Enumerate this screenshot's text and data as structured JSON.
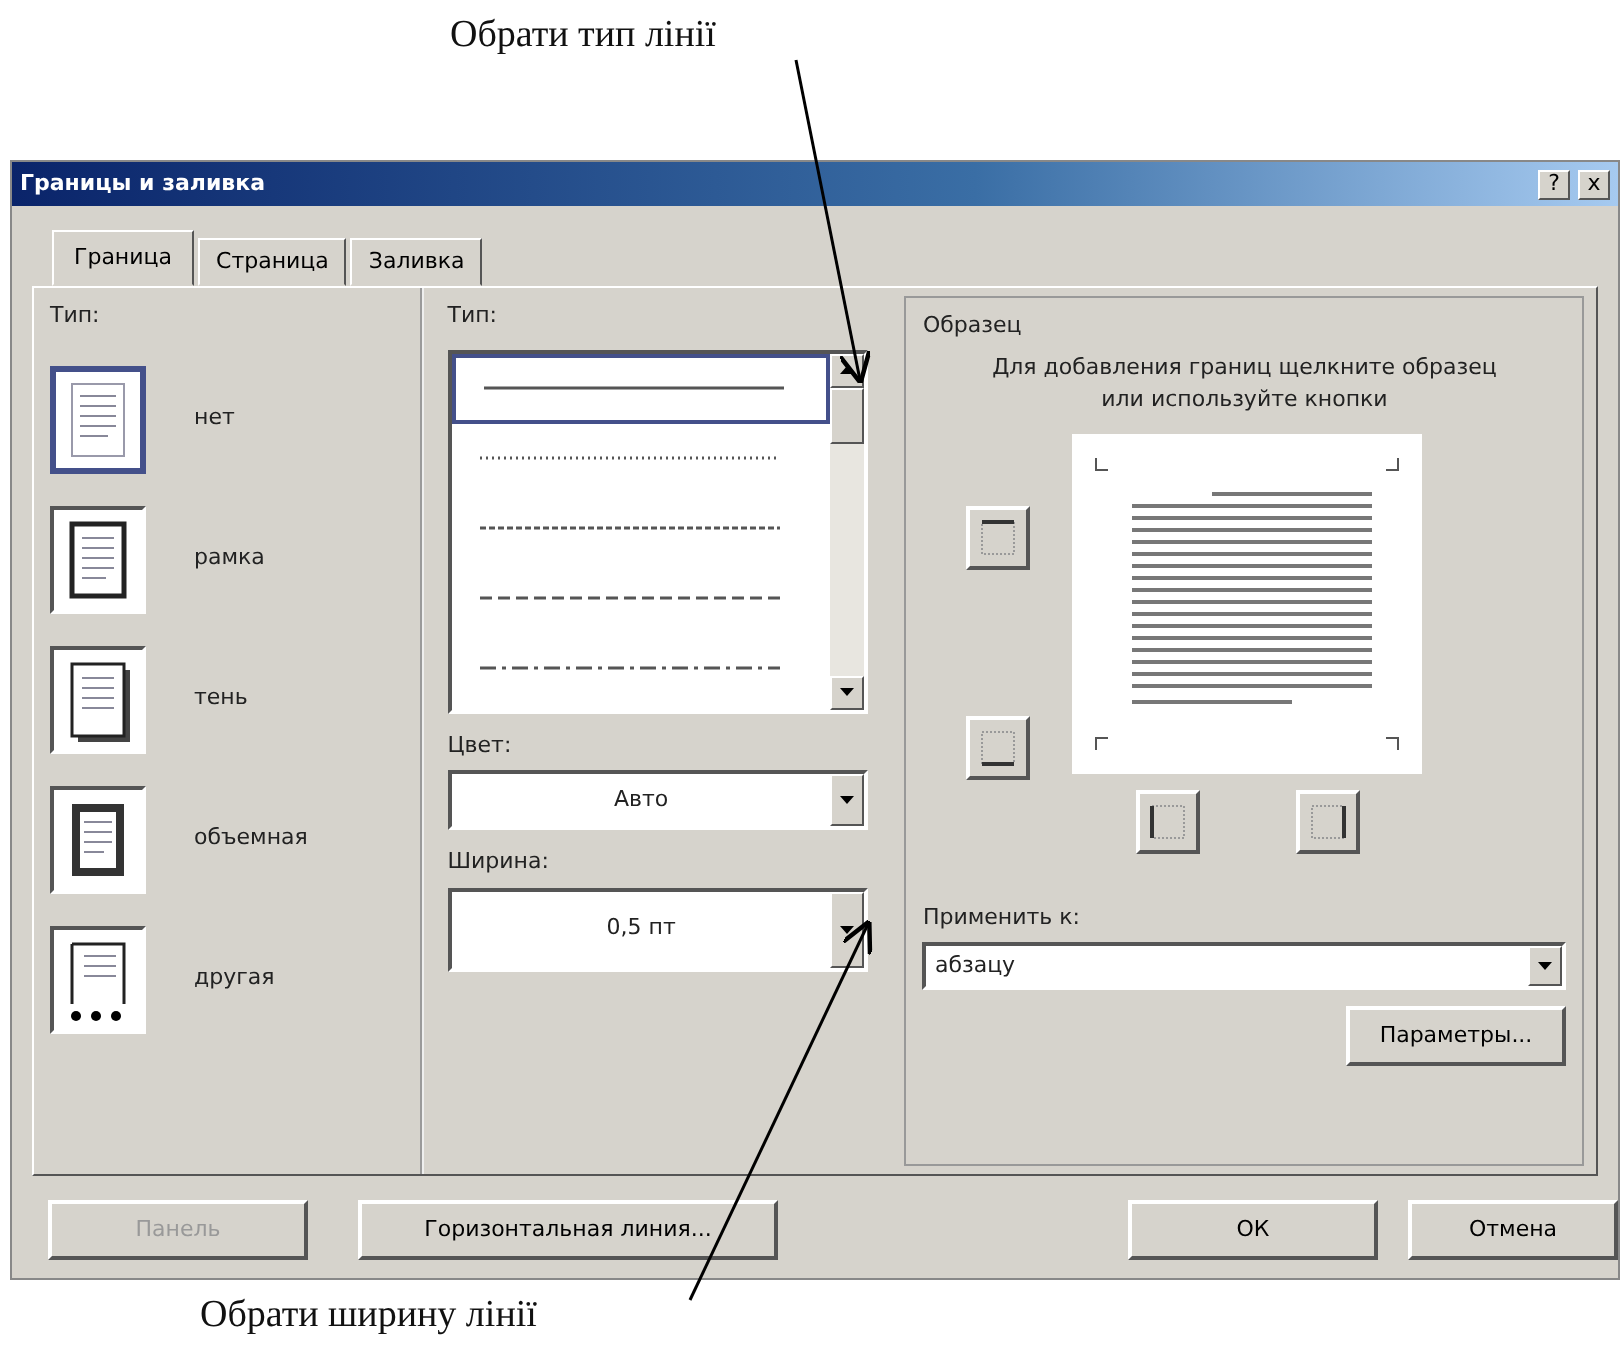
{
  "top_annotation": {
    "text": "Обрати тип лінії"
  },
  "bottom_annotation": {
    "text": "Обрати ширину лінії"
  },
  "window": {
    "title": "Границы и заливка",
    "title_buttons": [
      "?",
      "x"
    ]
  },
  "tabs": [
    {
      "label": "Граница",
      "selected": true
    },
    {
      "label": "Страница",
      "selected": false
    },
    {
      "label": "Заливка",
      "selected": false
    }
  ],
  "setting": {
    "label": "Тип:",
    "items": [
      {
        "label": "нет",
        "kind": "none",
        "selected": true
      },
      {
        "label": "рамка",
        "kind": "box",
        "selected": false
      },
      {
        "label": "тень",
        "kind": "shadow",
        "selected": false
      },
      {
        "label": "объемная",
        "kind": "raised",
        "selected": false
      },
      {
        "label": "другая",
        "kind": "custom",
        "selected": false
      }
    ]
  },
  "style": {
    "label": "Тип:",
    "lines": [
      {
        "kind": "solid",
        "selected": true
      },
      {
        "kind": "dotted",
        "selected": false
      },
      {
        "kind": "dense-dash",
        "selected": false
      },
      {
        "kind": "dashed",
        "selected": false
      },
      {
        "kind": "dash-dot",
        "selected": false
      }
    ]
  },
  "color": {
    "label": "Цвет:",
    "value": "Авто"
  },
  "width": {
    "label": "Ширина:",
    "value": "0,5 пт"
  },
  "preview": {
    "label": "Образец",
    "hint": "Для добавления границ щелкните образец или используйте кнопки"
  },
  "apply_to": {
    "label": "Применить к:",
    "value": "абзацу"
  },
  "options_button": {
    "label": "Параметры..."
  },
  "buttons": [
    {
      "label": "Панель",
      "disabled": true
    },
    {
      "label": "Горизонтальная линия...",
      "disabled": false
    },
    {
      "label": "ОК",
      "disabled": false
    },
    {
      "label": "Отмена",
      "disabled": false
    }
  ]
}
